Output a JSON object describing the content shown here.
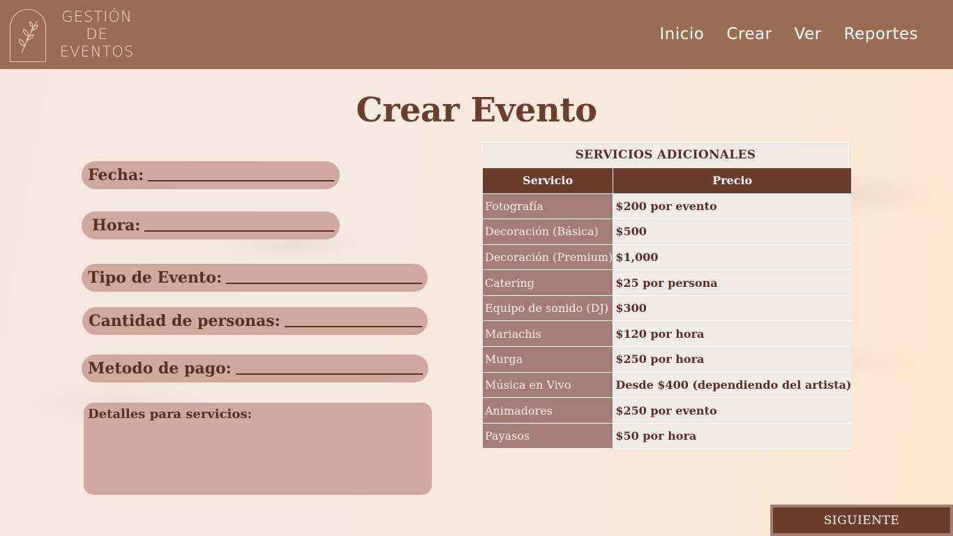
{
  "header": {
    "logo_lines": [
      "GESTIÓN",
      "DE",
      "EVENTOS"
    ],
    "nav": [
      "Inicio",
      "Crear",
      "Ver",
      "Reportes"
    ]
  },
  "page_title": "Crear Evento",
  "form": {
    "fecha_label": "Fecha:",
    "hora_label": "Hora:",
    "tipo_label": "Tipo de Evento:",
    "cantidad_label": "Cantidad de personas:",
    "metodo_label": "Metodo de pago:",
    "detalles_label": "Detalles para servicios:"
  },
  "services": {
    "title": "SERVICIOS ADICIONALES",
    "headers": [
      "Servicio",
      "Precio"
    ],
    "rows": [
      {
        "name": "Fotografía",
        "price": "$200 por evento"
      },
      {
        "name": "Decoración (Básica)",
        "price": "$500"
      },
      {
        "name": "Decoración (Premium)",
        "price": "$1,000"
      },
      {
        "name": "Catering",
        "price": "$25 por persona"
      },
      {
        "name": "Equipo de sonido (DJ)",
        "price": "$300"
      },
      {
        "name": "Mariachis",
        "price": "$120 por hora"
      },
      {
        "name": "Murga",
        "price": "$250 por hora"
      },
      {
        "name": "Música en Vivo",
        "price": "Desde $400 (dependiendo del artista)"
      },
      {
        "name": "Animadores",
        "price": "$250 por evento"
      },
      {
        "name": "Payasos",
        "price": "$50 por hora"
      }
    ]
  },
  "next_button": "SIGUIENTE",
  "colors": {
    "header": "#9a6b55",
    "accent_dark": "#6b3c2b",
    "pill": "#cfa89e",
    "service_cell": "#a47e74"
  },
  "icons": {
    "logo": "leaf-branch-icon"
  }
}
